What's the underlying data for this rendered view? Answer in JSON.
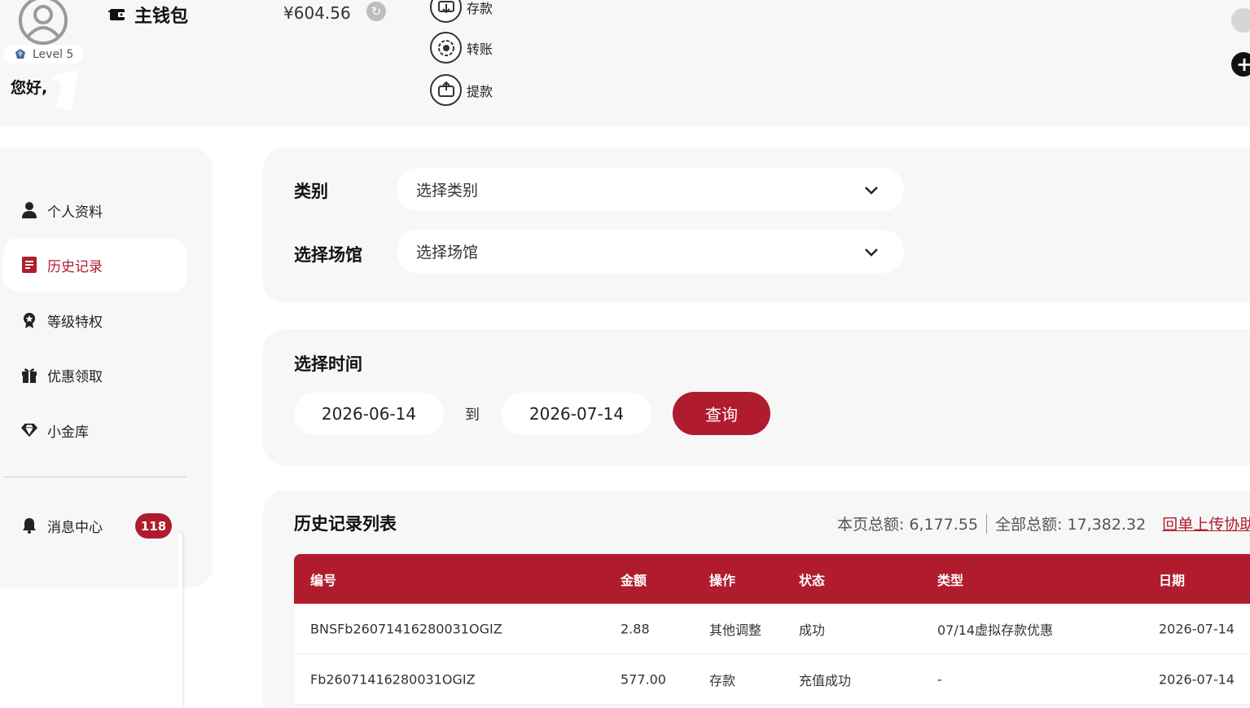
{
  "header": {
    "level": "Level 5",
    "greeting": "您好,",
    "wallet_label": "主钱包",
    "balance": "¥604.56",
    "actions": [
      {
        "label": "存款",
        "icon": "deposit-icon"
      },
      {
        "label": "转账",
        "icon": "transfer-icon"
      },
      {
        "label": "提款",
        "icon": "withdraw-icon"
      }
    ]
  },
  "sidebar": {
    "items": [
      {
        "label": "个人资料",
        "icon": "user-icon"
      },
      {
        "label": "历史记录",
        "icon": "document-icon",
        "active": true
      },
      {
        "label": "等级特权",
        "icon": "medal-icon"
      },
      {
        "label": "优惠领取",
        "icon": "gift-icon"
      },
      {
        "label": "小金库",
        "icon": "diamond-icon"
      }
    ],
    "messages": {
      "label": "消息中心",
      "icon": "bell-icon",
      "count": "118"
    }
  },
  "filters": {
    "category_label": "类别",
    "category_placeholder": "选择类别",
    "venue_label": "选择场馆",
    "venue_placeholder": "选择场馆"
  },
  "time": {
    "label": "选择时间",
    "from": "2026-06-14",
    "to_label": "到",
    "to": "2026-07-14",
    "query_label": "查询"
  },
  "history": {
    "title": "历史记录列表",
    "page_total": "本页总额: 6,177.55",
    "all_total": "全部总额: 17,382.32",
    "help_link": "回单上传协助",
    "columns": [
      "编号",
      "金额",
      "操作",
      "状态",
      "类型",
      "日期"
    ],
    "rows": [
      [
        "BNSFb26071416280031OGIZ",
        "2.88",
        "其他调整",
        "成功",
        "07/14虚拟存款优惠",
        "2026-07-14"
      ],
      [
        "Fb26071416280031OGIZ",
        "577.00",
        "存款",
        "充值成功",
        "-",
        "2026-07-14"
      ]
    ]
  },
  "colors": {
    "accent": "#b01c2e",
    "panel": "#f7f7f7"
  }
}
